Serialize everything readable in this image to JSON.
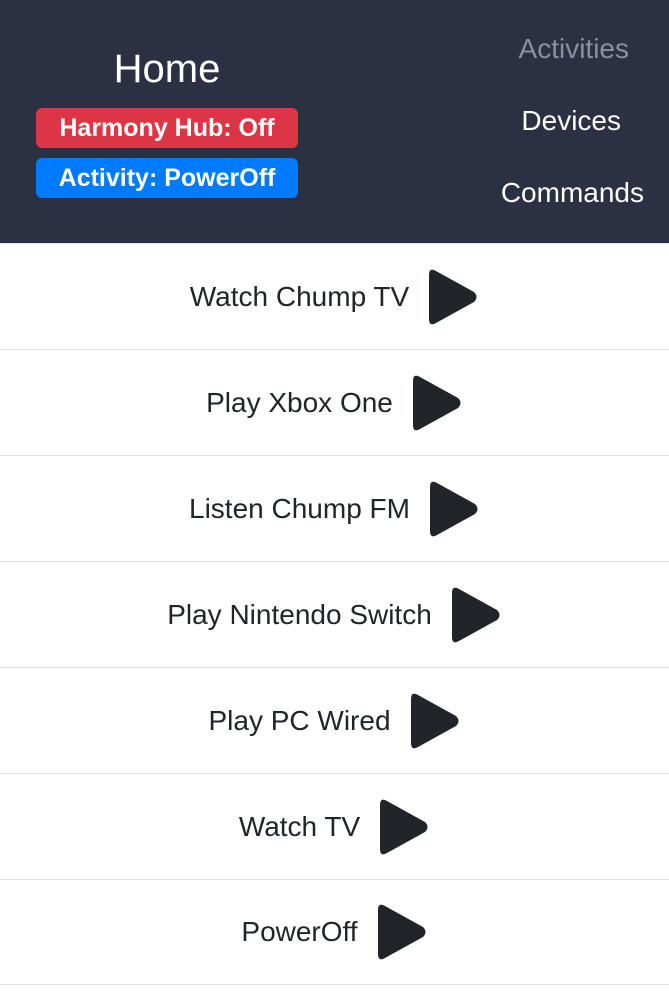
{
  "header": {
    "title": "Home",
    "hub_badge": "Harmony Hub: Off",
    "activity_badge": "Activity: PowerOff"
  },
  "nav": {
    "items": [
      {
        "label": "Activities",
        "color": "#8a90a0",
        "active": true
      },
      {
        "label": "Devices",
        "color": "#ffffff",
        "active": false
      },
      {
        "label": "Commands",
        "color": "#ffffff",
        "active": false
      }
    ]
  },
  "activities": [
    {
      "label": "Watch Chump TV",
      "icon": "play-icon"
    },
    {
      "label": "Play Xbox One",
      "icon": "play-icon"
    },
    {
      "label": "Listen Chump FM",
      "icon": "play-icon"
    },
    {
      "label": "Play Nintendo Switch",
      "icon": "play-icon"
    },
    {
      "label": "Play PC Wired",
      "icon": "play-icon"
    },
    {
      "label": "Watch TV",
      "icon": "play-icon"
    },
    {
      "label": "PowerOff",
      "icon": "play-icon"
    }
  ],
  "colors": {
    "header_bg": "#2b3042",
    "badge_danger": "#dc3545",
    "badge_primary": "#007bff",
    "icon": "#212529"
  }
}
